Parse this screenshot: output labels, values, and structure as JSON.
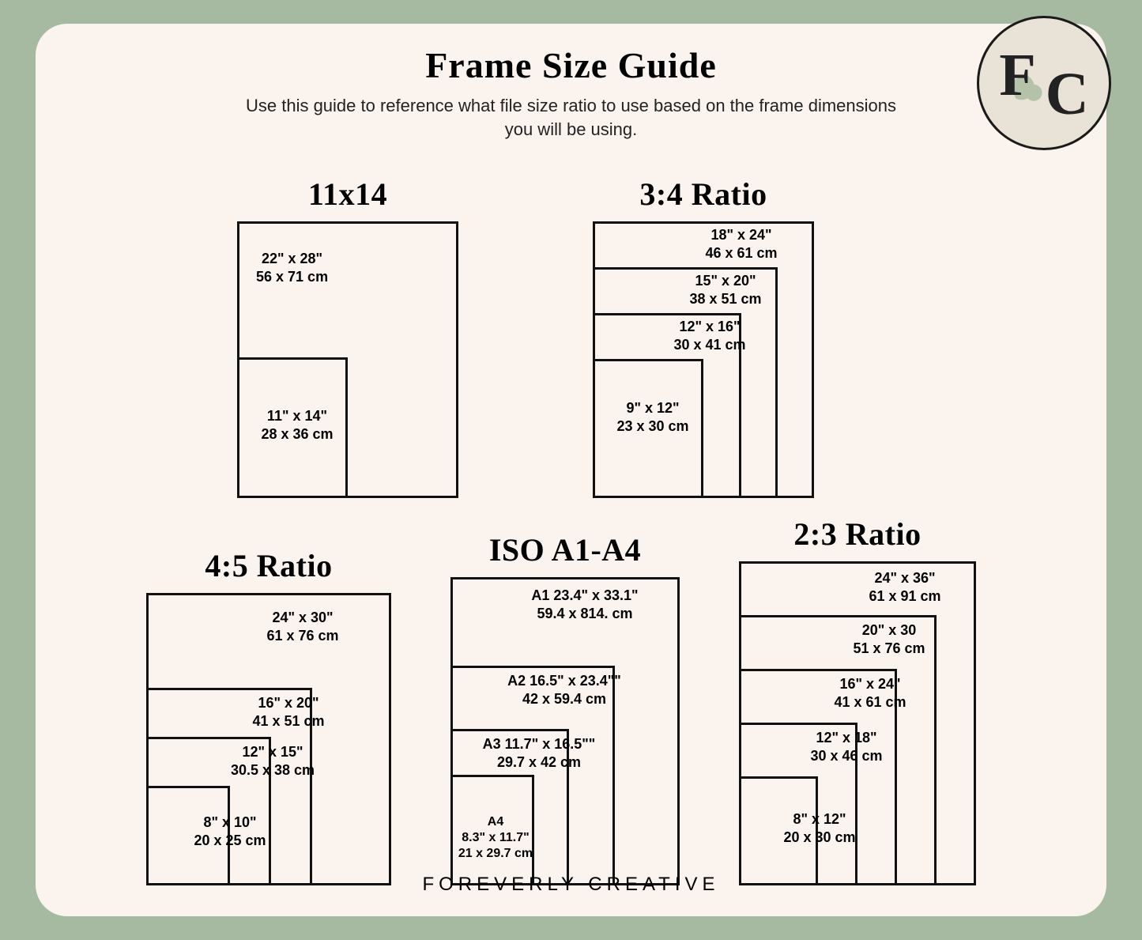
{
  "title": "Frame Size Guide",
  "subtitle": "Use this guide to reference what file size ratio to use based on the frame dimensions you will be using.",
  "footer": "FOREVERLY CREATIVE",
  "logo": {
    "letter1": "F",
    "letter2": "C"
  },
  "groups": {
    "g11x14": {
      "title": "11x14",
      "sizes": [
        {
          "in": "22\" x 28\"",
          "cm": "56 x 71 cm"
        },
        {
          "in": "11\" x 14\"",
          "cm": "28 x 36 cm"
        }
      ]
    },
    "g34": {
      "title": "3:4 Ratio",
      "sizes": [
        {
          "in": "18\" x 24\"",
          "cm": "46 x 61 cm"
        },
        {
          "in": "15\" x 20\"",
          "cm": "38 x 51 cm"
        },
        {
          "in": "12\" x 16\"",
          "cm": "30 x 41 cm"
        },
        {
          "in": "9\" x 12\"",
          "cm": "23 x 30 cm"
        }
      ]
    },
    "g45": {
      "title": "4:5 Ratio",
      "sizes": [
        {
          "in": "24\" x 30\"",
          "cm": "61 x 76 cm"
        },
        {
          "in": "16\" x 20\"",
          "cm": "41 x 51 cm"
        },
        {
          "in": "12\" x 15\"",
          "cm": "30.5 x 38 cm"
        },
        {
          "in": "8\" x 10\"",
          "cm": "20 x 25 cm"
        }
      ]
    },
    "giso": {
      "title": "ISO A1-A4",
      "sizes": [
        {
          "in": "A1 23.4\" x 33.1\"",
          "cm": "59.4 x 814. cm"
        },
        {
          "in": "A2 16.5\" x 23.4\"\"",
          "cm": "42 x 59.4 cm"
        },
        {
          "in": "A3 11.7\" x 16.5\"\"",
          "cm": "29.7 x 42 cm"
        },
        {
          "in": "A4",
          "cm": "8.3\" x 11.7\"",
          "cm2": "21 x 29.7 cm"
        }
      ]
    },
    "g23": {
      "title": "2:3 Ratio",
      "sizes": [
        {
          "in": "24\" x 36\"",
          "cm": "61 x 91 cm"
        },
        {
          "in": "20\" x 30",
          "cm": "51 x 76 cm"
        },
        {
          "in": "16\" x 24\"",
          "cm": "41 x 61 cm"
        },
        {
          "in": "12\" x 18\"",
          "cm": "30 x 46 cm"
        },
        {
          "in": "8\" x 12\"",
          "cm": "20 x 30 cm"
        }
      ]
    }
  }
}
